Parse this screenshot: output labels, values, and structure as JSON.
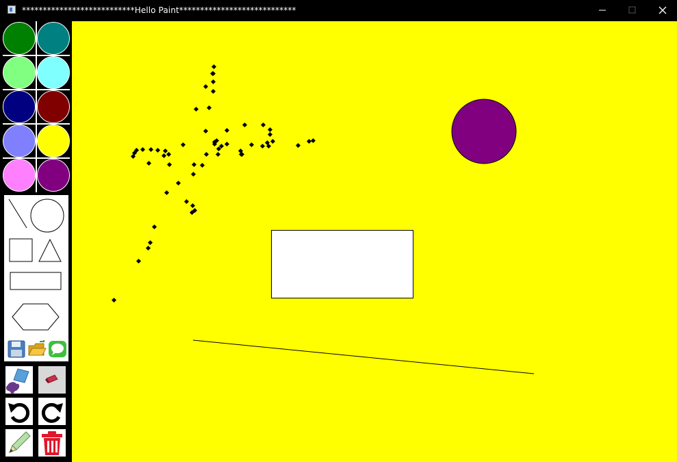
{
  "window": {
    "title": "***************************Hello Paint****************************"
  },
  "palette": {
    "colors": [
      "#008000",
      "#008080",
      "#80ff80",
      "#80ffff",
      "#000080",
      "#800000",
      "#8080ff",
      "#ffff00",
      "#ff80ff",
      "#800080"
    ]
  },
  "tools": {
    "shapes": [
      "line",
      "circle",
      "square",
      "triangle",
      "rectangle",
      "hexagon"
    ],
    "file_actions": [
      "save",
      "open",
      "chat"
    ],
    "actions": [
      "fill",
      "eraser",
      "undo",
      "redo",
      "pencil",
      "trash"
    ]
  },
  "canvas": {
    "background": "#ffff00",
    "objects": [
      "circle",
      "rectangle",
      "line",
      "freehand-dots"
    ],
    "circle_fill": "#800080",
    "rectangle_fill": "#ffffff"
  }
}
